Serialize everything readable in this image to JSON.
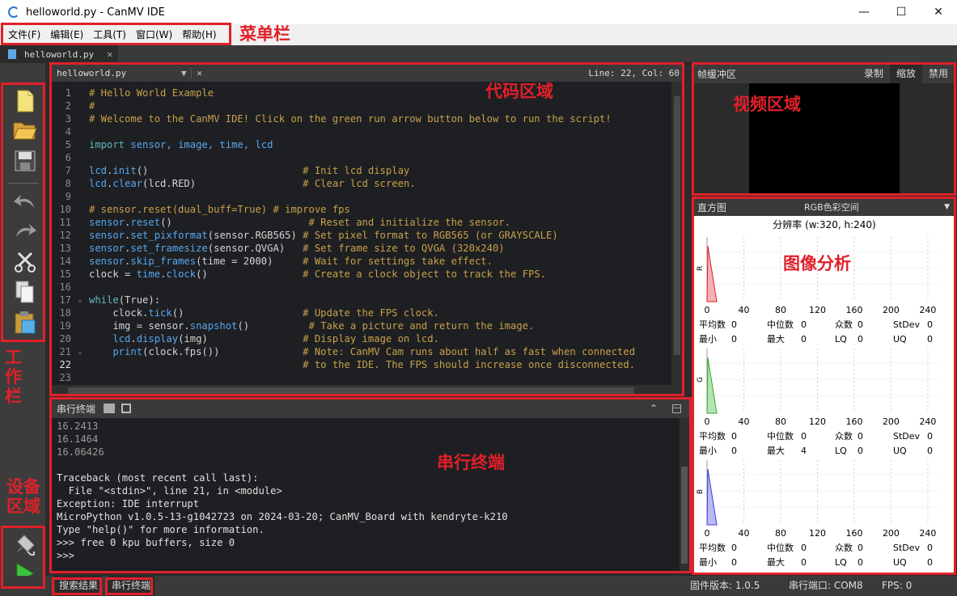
{
  "window": {
    "title": "helloworld.py - CanMV IDE"
  },
  "menu": [
    "文件(F)",
    "编辑(E)",
    "工具(T)",
    "窗口(W)",
    "帮助(H)"
  ],
  "file_tab": {
    "label": "helloworld.py"
  },
  "editor": {
    "filename": "helloworld.py",
    "position": "Line: 22, Col: 60",
    "lines": [
      [
        {
          "t": "# Hello World Example",
          "c": "c-com"
        }
      ],
      [
        {
          "t": "#",
          "c": "c-com"
        }
      ],
      [
        {
          "t": "# Welcome to the CanMV IDE! Click on the green run arrow button below to run the script!",
          "c": "c-com"
        }
      ],
      [],
      [
        {
          "t": "import",
          "c": "c-kw"
        },
        {
          "t": " sensor, image, time, lcd",
          "c": "c-fn"
        }
      ],
      [],
      [
        {
          "t": "lcd",
          "c": "c-fn"
        },
        {
          "t": ".",
          "c": "c-id"
        },
        {
          "t": "init",
          "c": "c-fn"
        },
        {
          "t": "()                          ",
          "c": "c-id"
        },
        {
          "t": "# Init lcd display",
          "c": "c-com"
        }
      ],
      [
        {
          "t": "lcd",
          "c": "c-fn"
        },
        {
          "t": ".",
          "c": "c-id"
        },
        {
          "t": "clear",
          "c": "c-fn"
        },
        {
          "t": "(lcd.RED)                  ",
          "c": "c-id"
        },
        {
          "t": "# Clear lcd screen.",
          "c": "c-com"
        }
      ],
      [],
      [
        {
          "t": "# sensor.reset(dual_buff=True) # improve fps",
          "c": "c-com"
        }
      ],
      [
        {
          "t": "sensor",
          "c": "c-fn"
        },
        {
          "t": ".",
          "c": "c-id"
        },
        {
          "t": "reset",
          "c": "c-fn"
        },
        {
          "t": "()                       ",
          "c": "c-id"
        },
        {
          "t": "# Reset and initialize the sensor.",
          "c": "c-com"
        }
      ],
      [
        {
          "t": "sensor",
          "c": "c-fn"
        },
        {
          "t": ".",
          "c": "c-id"
        },
        {
          "t": "set_pixformat",
          "c": "c-fn"
        },
        {
          "t": "(sensor.RGB565) ",
          "c": "c-id"
        },
        {
          "t": "# Set pixel format to RGB565 (or GRAYSCALE)",
          "c": "c-com"
        }
      ],
      [
        {
          "t": "sensor",
          "c": "c-fn"
        },
        {
          "t": ".",
          "c": "c-id"
        },
        {
          "t": "set_framesize",
          "c": "c-fn"
        },
        {
          "t": "(sensor.QVGA)   ",
          "c": "c-id"
        },
        {
          "t": "# Set frame size to QVGA (320x240)",
          "c": "c-com"
        }
      ],
      [
        {
          "t": "sensor",
          "c": "c-fn"
        },
        {
          "t": ".",
          "c": "c-id"
        },
        {
          "t": "skip_frames",
          "c": "c-fn"
        },
        {
          "t": "(time = 2000)     ",
          "c": "c-id"
        },
        {
          "t": "# Wait for settings take effect.",
          "c": "c-com"
        }
      ],
      [
        {
          "t": "clock = ",
          "c": "c-id"
        },
        {
          "t": "time",
          "c": "c-fn"
        },
        {
          "t": ".",
          "c": "c-id"
        },
        {
          "t": "clock",
          "c": "c-fn"
        },
        {
          "t": "()                ",
          "c": "c-id"
        },
        {
          "t": "# Create a clock object to track the FPS.",
          "c": "c-com"
        }
      ],
      [],
      [
        {
          "t": "while",
          "c": "c-kw"
        },
        {
          "t": "(True):",
          "c": "c-id"
        }
      ],
      [
        {
          "t": "    clock.",
          "c": "c-id"
        },
        {
          "t": "tick",
          "c": "c-fn"
        },
        {
          "t": "()                    ",
          "c": "c-id"
        },
        {
          "t": "# Update the FPS clock.",
          "c": "c-com"
        }
      ],
      [
        {
          "t": "    img = sensor.",
          "c": "c-id"
        },
        {
          "t": "snapshot",
          "c": "c-fn"
        },
        {
          "t": "()          ",
          "c": "c-id"
        },
        {
          "t": "# Take a picture and return the image.",
          "c": "c-com"
        }
      ],
      [
        {
          "t": "    lcd",
          "c": "c-fn"
        },
        {
          "t": ".",
          "c": "c-id"
        },
        {
          "t": "display",
          "c": "c-fn"
        },
        {
          "t": "(img)                ",
          "c": "c-id"
        },
        {
          "t": "# Display image on lcd.",
          "c": "c-com"
        }
      ],
      [
        {
          "t": "    print",
          "c": "c-fn"
        },
        {
          "t": "(clock.fps())              ",
          "c": "c-id"
        },
        {
          "t": "# Note: CanMV Cam runs about half as fast when connected",
          "c": "c-com"
        }
      ],
      [
        {
          "t": "                                    ",
          "c": "c-id"
        },
        {
          "t": "# to the IDE. The FPS should increase once disconnected.",
          "c": "c-com"
        }
      ],
      []
    ]
  },
  "terminal": {
    "title": "串行终端",
    "lines": [
      {
        "t": "16.2413",
        "dim": true
      },
      {
        "t": "16.1464",
        "dim": true
      },
      {
        "t": "16.06426",
        "dim": true
      },
      {
        "t": "",
        "dim": false
      },
      {
        "t": "Traceback (most recent call last):",
        "dim": false
      },
      {
        "t": "  File \"<stdin>\", line 21, in <module>",
        "dim": false
      },
      {
        "t": "Exception: IDE interrupt",
        "dim": false
      },
      {
        "t": "MicroPython v1.0.5-13-g1042723 on 2024-03-20; CanMV_Board with kendryte-k210",
        "dim": false
      },
      {
        "t": "Type \"help()\" for more information.",
        "dim": false
      },
      {
        "t": ">>> free 0 kpu buffers, size 0",
        "dim": false
      },
      {
        "t": ">>>",
        "dim": false
      }
    ]
  },
  "framebuffer": {
    "title": "帧缓冲区",
    "buttons": [
      "录制",
      "缩放",
      "禁用"
    ]
  },
  "histogram": {
    "title": "直方图",
    "color_space": "RGB色彩空间",
    "resolution": "分辨率 (w:320, h:240)",
    "x_ticks": [
      "0",
      "40",
      "80",
      "120",
      "160",
      "200",
      "240"
    ],
    "channels": [
      {
        "name": "R",
        "color": "#e0202a",
        "peak": 0.86,
        "stats": {
          "mean": "0",
          "median": "0",
          "mode": "0",
          "stdev": "0",
          "min": "0",
          "max": "0",
          "lq": "0",
          "uq": "0"
        }
      },
      {
        "name": "G",
        "color": "#2ab02a",
        "peak": 0.86,
        "stats": {
          "mean": "0",
          "median": "0",
          "mode": "0",
          "stdev": "0",
          "min": "0",
          "max": "4",
          "lq": "0",
          "uq": "0"
        }
      },
      {
        "name": "B",
        "color": "#3a3ae0",
        "peak": 0.86,
        "stats": {
          "mean": "0",
          "median": "0",
          "mode": "0",
          "stdev": "0",
          "min": "0",
          "max": "0",
          "lq": "0",
          "uq": "0"
        }
      }
    ],
    "stat_labels": {
      "mean": "平均数",
      "median": "中位数",
      "mode": "众数",
      "stdev": "StDev",
      "min": "最小",
      "max": "最大",
      "lq": "LQ",
      "uq": "UQ"
    }
  },
  "status": {
    "tab_search": "搜索结果",
    "tab_terminal": "串行终端",
    "firmware": "固件版本: 1.0.5",
    "serial_port": "串行端口: COM8",
    "fps": "FPS: 0"
  },
  "annotations": {
    "menubar": "菜单栏",
    "code": "代码区域",
    "video": "视频区域",
    "image_analysis": "图像分析",
    "serial": "串行终端",
    "toolbar": "工作栏",
    "device": "设备区域"
  }
}
